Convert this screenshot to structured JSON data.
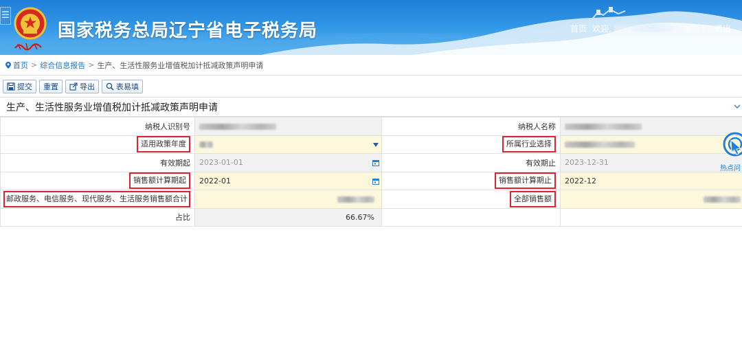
{
  "header": {
    "site_title": "国家税务总局辽宁省电子税务局",
    "menu_toggle": "☰",
    "nav_home": "首页",
    "nav_welcome": "欢迎,",
    "nav_separator": "|",
    "nav_logout": "退出"
  },
  "breadcrumb": {
    "home": "首页",
    "report": "综合信息报告",
    "current": "生产、生活性服务业增值税加计抵减政策声明申请",
    "separator": ">"
  },
  "toolbar": {
    "submit": "提交",
    "reset": "重置",
    "export": "导出",
    "form_fill": "表易填"
  },
  "section": {
    "title": "生产、生活性服务业增值税加计抵减政策声明申请"
  },
  "form": {
    "taxpayer_id_label": "纳税人识别号",
    "taxpayer_name_label": "纳税人名称",
    "policy_year_label": "适用政策年度",
    "industry_label": "所属行业选择",
    "valid_from_label": "有效期起",
    "valid_from_value": "2023-01-01",
    "valid_to_label": "有效期止",
    "valid_to_value": "2023-12-31",
    "sales_from_label": "销售额计算期起",
    "sales_from_value": "2022-01",
    "sales_to_label": "销售额计算期止",
    "sales_to_value": "2022-12",
    "service_sales_label": "邮政服务、电信服务、现代服务、生活服务销售额合计",
    "total_sales_label": "全部销售额",
    "ratio_label": "占比",
    "ratio_value": "66.67%"
  },
  "widget": {
    "hotspot_label": "热点问"
  },
  "colors": {
    "banner_top": "#1f7fd8",
    "link": "#1a72c9",
    "highlight_border": "#d9232d",
    "editable_bg": "#fdf7dc",
    "readonly_bg": "#f1f1f1"
  }
}
